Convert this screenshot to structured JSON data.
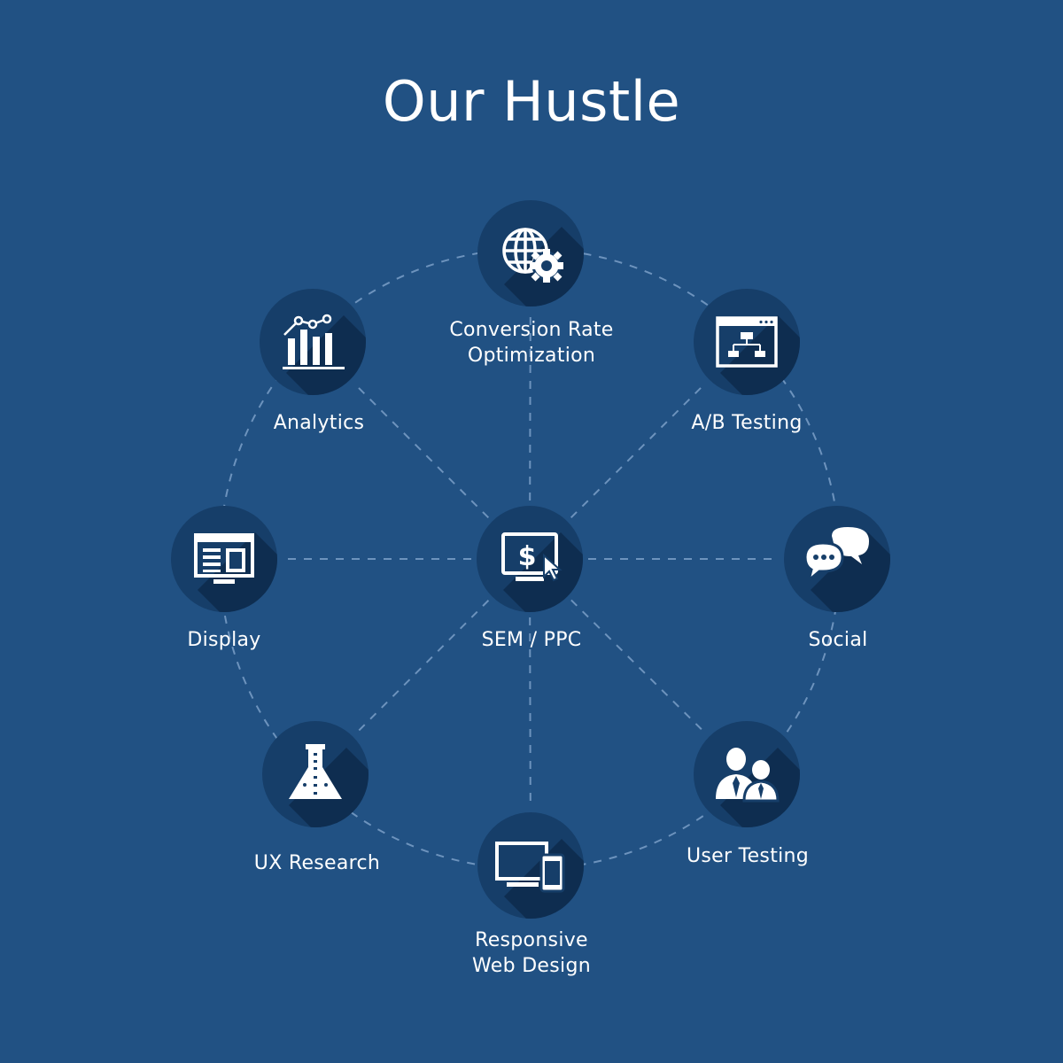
{
  "title": "Our Hustle",
  "colors": {
    "background": "#215183",
    "circle": "#163e69",
    "shadow": "#0e2d50",
    "connector": "#6d93bd",
    "icon": "#ffffff"
  },
  "nodes": [
    {
      "id": "cro",
      "icon": "globe-gear-icon",
      "label": [
        "Conversion Rate",
        "Optimization"
      ]
    },
    {
      "id": "ab-testing",
      "icon": "sitemap-window-icon",
      "label": [
        "A/B Testing"
      ]
    },
    {
      "id": "social",
      "icon": "chat-bubbles-icon",
      "label": [
        "Social"
      ]
    },
    {
      "id": "user-testing",
      "icon": "users-icon",
      "label": [
        "User Testing"
      ]
    },
    {
      "id": "responsive-web-design",
      "icon": "devices-icon",
      "label": [
        "Responsive",
        "Web Design"
      ]
    },
    {
      "id": "ux-research",
      "icon": "flask-icon",
      "label": [
        "UX Research"
      ]
    },
    {
      "id": "display",
      "icon": "monitor-layout-icon",
      "label": [
        "Display"
      ]
    },
    {
      "id": "analytics",
      "icon": "bar-line-chart-icon",
      "label": [
        "Analytics"
      ]
    },
    {
      "id": "sem-ppc",
      "icon": "monitor-dollar-cursor-icon",
      "label": [
        "SEM / PPC"
      ]
    }
  ]
}
